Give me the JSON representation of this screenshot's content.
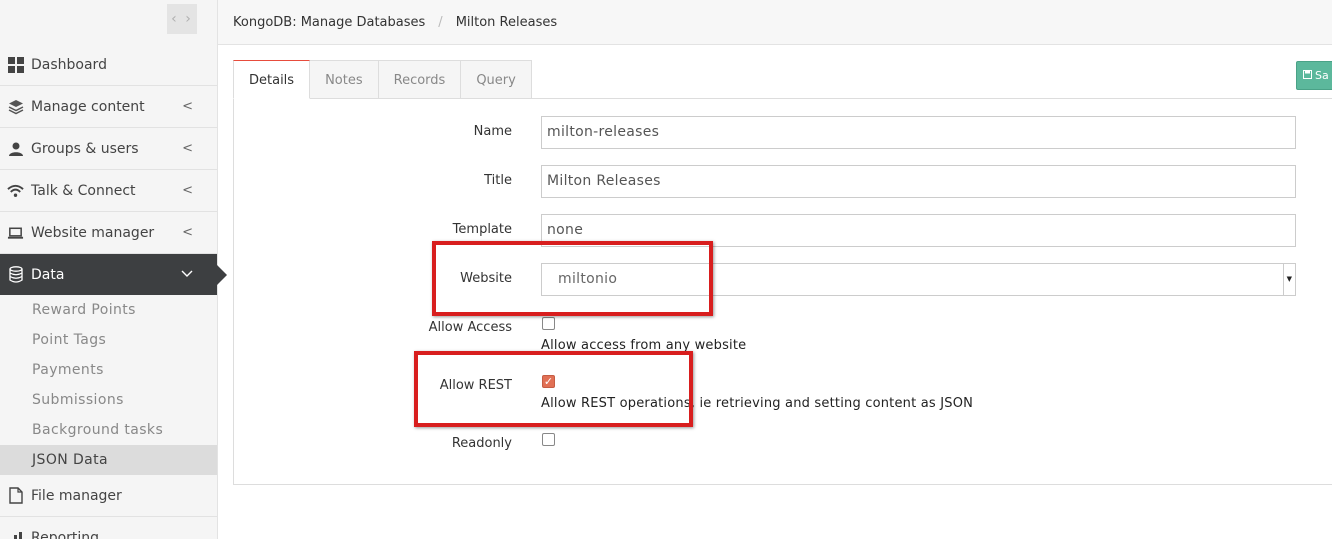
{
  "sidebar": {
    "toggle_icon": "arrows-left-right-icon",
    "items": [
      {
        "label": "Dashboard",
        "icon": "grid-icon",
        "has_chevron": false
      },
      {
        "label": "Manage content",
        "icon": "layers-icon",
        "has_chevron": true
      },
      {
        "label": "Groups & users",
        "icon": "user-icon",
        "has_chevron": true
      },
      {
        "label": "Talk & Connect",
        "icon": "wifi-icon",
        "has_chevron": true
      },
      {
        "label": "Website manager",
        "icon": "laptop-icon",
        "has_chevron": true
      },
      {
        "label": "Data",
        "icon": "database-icon",
        "has_chevron": true,
        "active": true
      }
    ],
    "data_subitems": [
      "Reward Points",
      "Point Tags",
      "Payments",
      "Submissions",
      "Background tasks",
      "JSON Data"
    ],
    "after_items": [
      {
        "label": "File manager",
        "icon": "file-icon"
      },
      {
        "label": "Reporting",
        "icon": "chart-icon"
      }
    ]
  },
  "header": {
    "breadcrumb_parent": "KongoDB: Manage Databases",
    "breadcrumb_separator": "/",
    "breadcrumb_current": "Milton Releases"
  },
  "tabs": [
    "Details",
    "Notes",
    "Records",
    "Query"
  ],
  "save_button": {
    "label": "Sa"
  },
  "form": {
    "name_label": "Name",
    "name_value": "milton-releases",
    "title_label": "Title",
    "title_value": "Milton Releases",
    "template_label": "Template",
    "template_value": "none",
    "website_label": "Website",
    "website_value": "miltonio",
    "allow_access_label": "Allow Access",
    "allow_access_checked": false,
    "allow_access_help": "Allow access from any website",
    "allow_rest_label": "Allow REST",
    "allow_rest_checked": true,
    "allow_rest_help": "Allow REST operations, ie retrieving and setting content as JSON",
    "readonly_label": "Readonly",
    "readonly_checked": false
  },
  "colors": {
    "sidebar_active_bg": "#3d3f41",
    "tab_active_top": "#e74c3c",
    "save_button": "#5cb89c",
    "highlight_box": "#d81e1e",
    "checkbox_checked": "#e17055"
  }
}
